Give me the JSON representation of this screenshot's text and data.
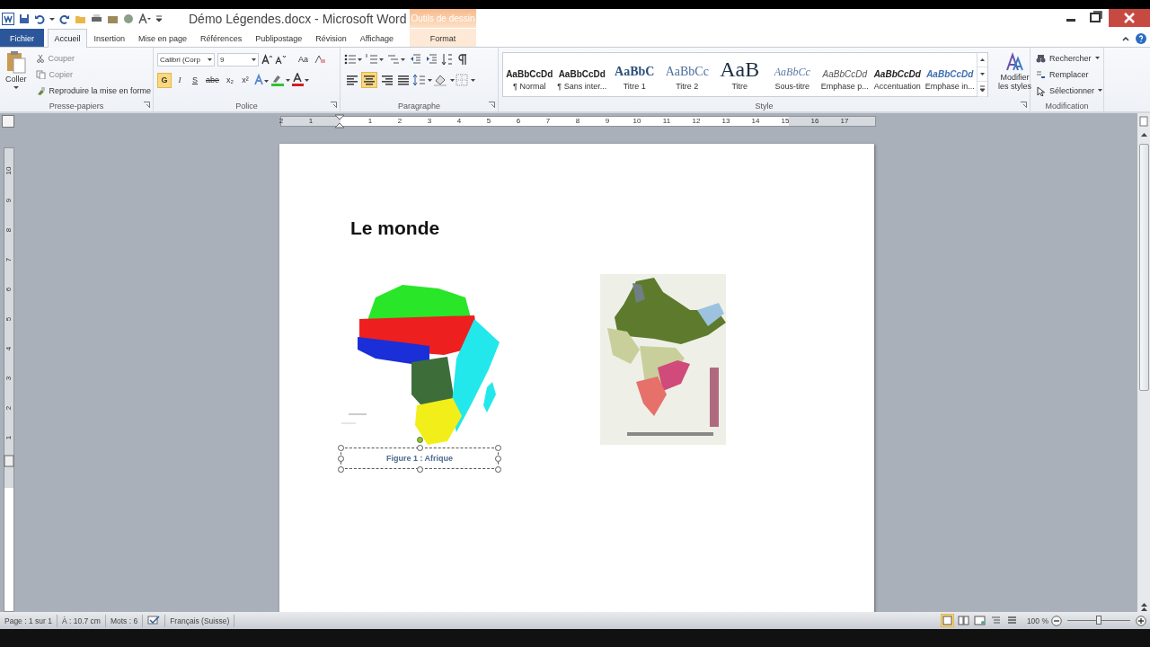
{
  "window": {
    "title": "Démo Légendes.docx - Microsoft Word",
    "contextual_group": "Outils de dessin"
  },
  "tabs": [
    {
      "label": "Fichier",
      "kind": "file",
      "selected": false
    },
    {
      "label": "Accueil",
      "kind": "normal",
      "selected": true
    },
    {
      "label": "Insertion",
      "kind": "normal",
      "selected": false
    },
    {
      "label": "Mise en page",
      "kind": "normal",
      "selected": false
    },
    {
      "label": "Références",
      "kind": "normal",
      "selected": false
    },
    {
      "label": "Publipostage",
      "kind": "normal",
      "selected": false
    },
    {
      "label": "Révision",
      "kind": "normal",
      "selected": false
    },
    {
      "label": "Affichage",
      "kind": "normal",
      "selected": false
    },
    {
      "label": "Format",
      "kind": "contextual",
      "selected": false
    }
  ],
  "clipboard": {
    "title": "Presse-papiers",
    "paste": "Coller",
    "commands": [
      "Couper",
      "Copier",
      "Reproduire la mise en forme"
    ]
  },
  "font": {
    "title": "Police",
    "font_name": "Calibri (Corp",
    "font_size": "9",
    "case_button": "Aa",
    "format_buttons": [
      {
        "label": "G",
        "on": true
      },
      {
        "label": "I",
        "on": false
      },
      {
        "label": "S",
        "on": false
      },
      {
        "label": "abe",
        "on": false
      },
      {
        "label": "x₂",
        "on": false
      },
      {
        "label": "x²",
        "on": false
      }
    ]
  },
  "paragraph": {
    "title": "Paragraphe",
    "alignments": [
      {
        "kind": "left",
        "selected": false
      },
      {
        "kind": "center",
        "selected": true
      },
      {
        "kind": "right",
        "selected": false
      },
      {
        "kind": "justify",
        "selected": false
      }
    ]
  },
  "styles": {
    "title": "Style",
    "change_styles": "Modifier les styles",
    "items": [
      {
        "preview": "AaBbCcDd",
        "name": "¶ Normal",
        "kind": "normal"
      },
      {
        "preview": "AaBbCcDd",
        "name": "¶ Sans inter...",
        "kind": "normal"
      },
      {
        "preview": "AaBbC",
        "name": "Titre 1",
        "kind": "heading1"
      },
      {
        "preview": "AaBbCc",
        "name": "Titre 2",
        "kind": "heading2"
      },
      {
        "preview": "AaB",
        "name": "Titre",
        "kind": "title"
      },
      {
        "preview": "AaBbCc",
        "name": "Sous-titre",
        "kind": "subtitle"
      },
      {
        "preview": "AaBbCcDd",
        "name": "Emphase p...",
        "kind": "emphasis"
      },
      {
        "preview": "AaBbCcDd",
        "name": "Accentuation",
        "kind": "strong"
      },
      {
        "preview": "AaBbCcDd",
        "name": "Emphase in...",
        "kind": "intense"
      }
    ]
  },
  "editing": {
    "title": "Modification",
    "commands": [
      {
        "label": "Rechercher",
        "kind": "find"
      },
      {
        "label": "Remplacer",
        "kind": "replace"
      },
      {
        "label": "Sélectionner",
        "kind": "select"
      }
    ]
  },
  "ruler": {
    "left_marks": [
      "2",
      "1"
    ],
    "marks": [
      "1",
      "2",
      "3",
      "4",
      "5",
      "6",
      "7",
      "8",
      "9",
      "10",
      "11",
      "12",
      "13",
      "14",
      "15",
      "16",
      "17"
    ],
    "vertical_marks": [
      "10",
      "9",
      "8",
      "7",
      "6",
      "5",
      "4",
      "3",
      "2",
      "1"
    ]
  },
  "document": {
    "heading": "Le monde",
    "figures": [
      {
        "kind": "africa",
        "caption": {
          "text": "Figure 1 : Afrique",
          "selected": true
        }
      },
      {
        "kind": "india"
      }
    ]
  },
  "status_bar": {
    "page": "Page : 1 sur 1",
    "position": "À : 10.7 cm",
    "words": "Mots : 6",
    "language": "Français (Suisse)",
    "zoom": "100 %",
    "zoom_slider": {
      "level": 0.5
    },
    "views": [
      {
        "kind": "print",
        "selected": true
      },
      {
        "kind": "reading",
        "selected": false
      },
      {
        "kind": "web",
        "selected": false
      },
      {
        "kind": "outline",
        "selected": false
      },
      {
        "kind": "draft",
        "selected": false
      }
    ]
  }
}
